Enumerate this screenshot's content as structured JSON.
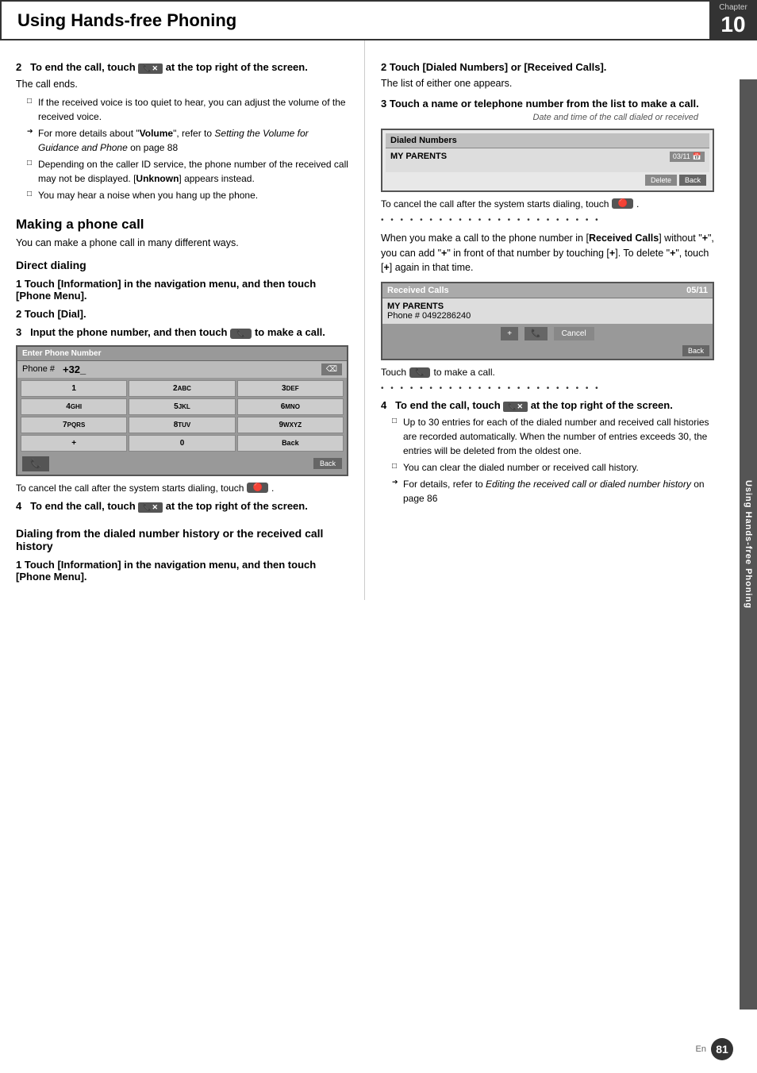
{
  "header": {
    "title": "Using Hands-free Phoning",
    "chapter_label": "Chapter",
    "chapter_number": "10"
  },
  "side_label": "Using Hands-free Phoning",
  "left_column": {
    "section2_heading": "2   To end the call, touch   at the top right of the screen.",
    "call_ends": "The call ends.",
    "bullets_step2": [
      "If the received voice is too quiet to hear, you can adjust the volume of the received voice.",
      "For more details about \"Volume\", refer to Setting the Volume for Guidance and Phone on page 88",
      "Depending on the caller ID service, the phone number of the received call may not be displayed. [Unknown] appears instead.",
      "You may hear a noise when you hang up the phone."
    ],
    "making_call_title": "Making a phone call",
    "making_call_body": "You can make a phone call in many different ways.",
    "direct_dialing_title": "Direct dialing",
    "step1_direct": "1   Touch [Information] in the navigation menu, and then touch [Phone Menu].",
    "step2_direct": "2   Touch [Dial].",
    "step3_direct": "3   Input the phone number, and then touch      to make a call.",
    "screen_phone_title": "Enter Phone Number",
    "phone_label": "Phone #",
    "phone_value": "+32_",
    "keypad_rows": [
      [
        "1",
        "2ABC",
        "3DEF"
      ],
      [
        "4GHI",
        "5JKL",
        "6MNO"
      ],
      [
        "7PQRS",
        "8TUV",
        "9WXYZ"
      ],
      [
        "+",
        "0",
        "Back"
      ]
    ],
    "cancel_text": "To cancel the call after the system starts dialing, touch",
    "step4_direct": "4   To end the call, touch   at the top right of the screen.",
    "dialing_history_title": "Dialing from the dialed number history or the received call history",
    "step1_history": "1   Touch [Information] in the navigation menu, and then touch [Phone Menu]."
  },
  "right_column": {
    "step2_right": "2   Touch [Dialed Numbers] or [Received Calls].",
    "list_appears": "The list of either one appears.",
    "step3_right": "3   Touch a name or telephone number from the list to make a call.",
    "date_annotation": "Date and time of the call dialed or received",
    "dialed_numbers_screen_title": "Dialed Numbers",
    "dialed_entry": "MY PARENTS",
    "dialed_date": "03/11",
    "btn_delete": "Delete",
    "btn_back": "Back",
    "cancel_text2": "To cancel the call after the system starts dialing, touch",
    "dots_text1": "• • • • • • • • • • • • • • • • • • • • • • •",
    "plus_note": "When you make a call to the phone number in [Received Calls] without \"+\", you can add \"+\" in front of that number by touching [+]. To delete \"+\", touch [+] again in that time.",
    "received_calls_title": "Received Calls",
    "recv_entry_name": "MY PARENTS",
    "recv_entry_phone": "Phone # 0492286240",
    "recv_date": "05/11",
    "btn_plus": "+",
    "btn_call": "📞",
    "btn_cancel": "Cancel",
    "touch_call": "Touch      to make a call.",
    "dots_text2": "• • • • • • • • • • • • • • • • • • • • • • •",
    "step4_right": "4   To end the call, touch   at the top right of the screen.",
    "bullets_step4_right": [
      "Up to 30 entries for each of the dialed number and received call histories are recorded automatically. When the number of entries exceeds 30, the entries will be deleted from the oldest one.",
      "You can clear the dialed number or received call history.",
      "For details, refer to Editing the received call or dialed number history on page 86"
    ]
  },
  "page_number": "81",
  "en_label": "En"
}
